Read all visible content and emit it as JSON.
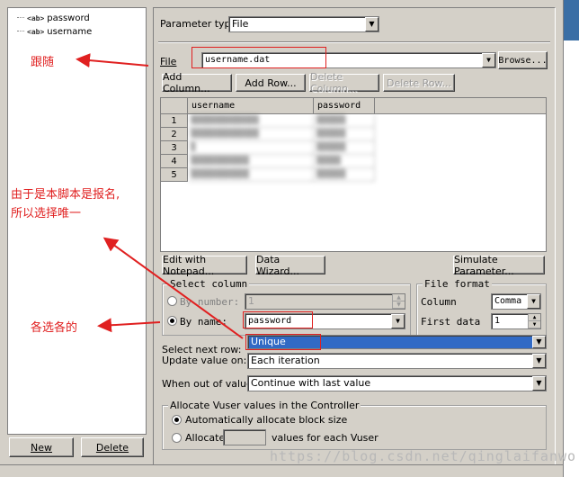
{
  "tree": {
    "items": [
      "password",
      "username"
    ]
  },
  "left_buttons": {
    "new": "New",
    "delete": "Delete"
  },
  "param_type": {
    "label": "Parameter type:",
    "value": "File"
  },
  "file": {
    "label": "File",
    "value": "username.dat",
    "browse": "Browse..."
  },
  "grid_buttons": {
    "add_column": "Add Column...",
    "add_row": "Add Row...",
    "delete_column": "Delete Column...",
    "delete_row": "Delete Row..."
  },
  "grid": {
    "columns": [
      "username",
      "password"
    ],
    "rows": [
      {
        "num": "1",
        "username": "",
        "password": ""
      },
      {
        "num": "2",
        "username": "",
        "password": ""
      },
      {
        "num": "3",
        "username": "",
        "password": ""
      },
      {
        "num": "4",
        "username": "",
        "password": ""
      },
      {
        "num": "5",
        "username": "",
        "password": ""
      }
    ]
  },
  "bottom_buttons": {
    "edit_notepad": "Edit with Notepad...",
    "data_wizard": "Data Wizard...",
    "simulate": "Simulate Parameter..."
  },
  "select_column": {
    "title": "Select column",
    "by_number": "By number:",
    "by_number_value": "1",
    "by_name": "By name:",
    "by_name_value": "password"
  },
  "file_format": {
    "title": "File format",
    "column_label": "Column",
    "column_value": "Comma",
    "first_data_label": "First data",
    "first_data_value": "1"
  },
  "options": {
    "select_next_row_label": "Select next row:",
    "select_next_row_value": "Unique",
    "update_value_label": "Update value on:",
    "update_value_value": "Each iteration",
    "out_of_values_label": "When out of values:",
    "out_of_values_value": "Continue with last value"
  },
  "allocate": {
    "title": "Allocate Vuser values in the Controller",
    "auto": "Automatically allocate block size",
    "manual_prefix": "Allocate",
    "manual_suffix": "values for each Vuser"
  },
  "annotations": {
    "follow": "跟随",
    "reason_line1": "由于是本脚本是报名,",
    "reason_line2": "所以选择唯一",
    "each": "各选各的"
  },
  "watermark": "https://blog.csdn.net/qinglaifanwo",
  "colors": {
    "annotation": "#e02020",
    "selection": "#316ac5",
    "face": "#d4d0c8"
  }
}
